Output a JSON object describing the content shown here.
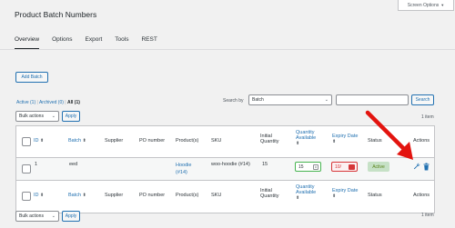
{
  "header": {
    "screen_options": "Screen Options",
    "title": "Product Batch Numbers"
  },
  "tabs": [
    {
      "label": "Overview",
      "active": true
    },
    {
      "label": "Options"
    },
    {
      "label": "Export"
    },
    {
      "label": "Tools"
    },
    {
      "label": "REST"
    }
  ],
  "toolbar": {
    "add_batch": "Add Batch",
    "filters": {
      "active": "Active (1)",
      "archived": "Archived (0)",
      "all": "All (1)",
      "separator": "|"
    },
    "search_by_label": "Search by",
    "search_by_value": "Batch",
    "search_button": "Search",
    "bulk_actions": "Bulk actions",
    "apply": "Apply",
    "item_count": "1 item"
  },
  "table": {
    "columns": {
      "id": "ID",
      "batch": "Batch",
      "supplier": "Supplier",
      "po_number": "PO number",
      "products": "Product(s)",
      "sku": "SKU",
      "initial_quantity_1": "Initial",
      "initial_quantity_2": "Quantity",
      "quantity_available_1": "Quantity",
      "quantity_available_2": "Available",
      "expiry_date": "Expiry Date",
      "status": "Status",
      "actions": "Actions"
    },
    "sort_glyph": "⬍",
    "rows": [
      {
        "id": "1",
        "batch": "eed",
        "supplier": "",
        "po_number": "",
        "product_1": "Hoodie",
        "product_2": "(#14)",
        "sku": "woo-hoodie (#14)",
        "initial_quantity": "15",
        "quantity_available": "15",
        "expiry_date": "10/",
        "status": "Active"
      }
    ]
  },
  "colors": {
    "link": "#2271b1",
    "active_badge_bg": "#c6e1c6",
    "active_badge_text": "#5b841b",
    "arrow": "#e3140f"
  },
  "icons": {
    "edit": "wrench-icon",
    "delete": "trash-icon"
  }
}
